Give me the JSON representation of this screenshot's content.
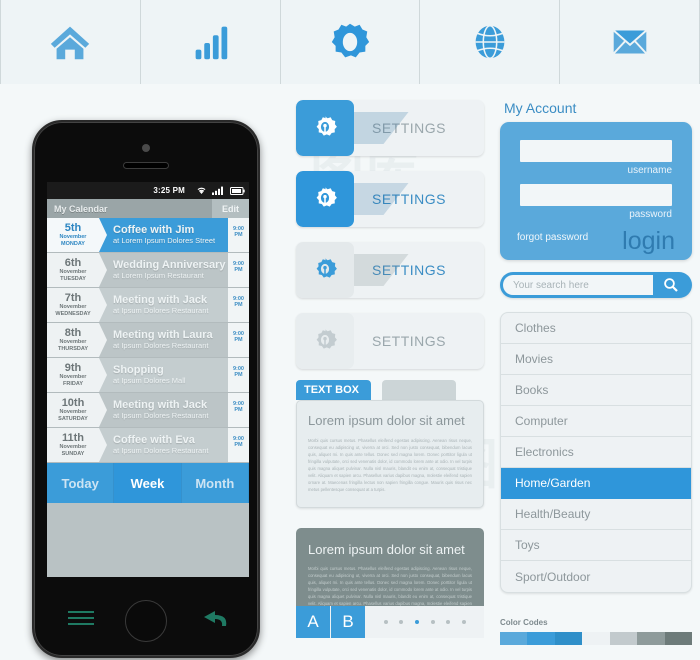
{
  "toolbar": {
    "items": [
      {
        "icon": "home-icon",
        "label": "Home"
      },
      {
        "icon": "bar-chart-icon",
        "label": "Statistics"
      },
      {
        "icon": "gear-icon",
        "label": "Settings"
      },
      {
        "icon": "globe-icon",
        "label": "Web"
      },
      {
        "icon": "envelope-icon",
        "label": "Mail"
      }
    ]
  },
  "phone": {
    "status": {
      "time": "3:25 PM",
      "wifi": "wifi-icon",
      "signal": "signal-icon",
      "battery": "battery-icon"
    },
    "calendar": {
      "title": "My Calendar",
      "edit_label": "Edit",
      "events": [
        {
          "day": "5th",
          "month": "November",
          "weekday": "MONDAY",
          "title": "Coffee with Jim",
          "place": "at Lorem Ipsum Dolores Street",
          "time1": "9:00",
          "time2": "PM",
          "active": true
        },
        {
          "day": "6th",
          "month": "November",
          "weekday": "TUESDAY",
          "title": "Wedding Anniversary",
          "place": "at Lorem Ipsum Restaurant",
          "time1": "9:00",
          "time2": "PM",
          "active": false
        },
        {
          "day": "7th",
          "month": "November",
          "weekday": "WEDNESDAY",
          "title": "Meeting with Jack",
          "place": "at Ipsum Dolores Restaurant",
          "time1": "9:00",
          "time2": "PM",
          "active": false
        },
        {
          "day": "8th",
          "month": "November",
          "weekday": "THURSDAY",
          "title": "Meeting with Laura",
          "place": "at Ipsum Dolores Restaurant",
          "time1": "9:00",
          "time2": "PM",
          "active": false
        },
        {
          "day": "9th",
          "month": "November",
          "weekday": "FRIDAY",
          "title": "Shopping",
          "place": "at Ipsum Dolores Mall",
          "time1": "9:00",
          "time2": "PM",
          "active": false
        },
        {
          "day": "10th",
          "month": "November",
          "weekday": "SATURDAY",
          "title": "Meeting with Jack",
          "place": "at Ipsum Dolores Restaurant",
          "time1": "9:00",
          "time2": "PM",
          "active": false
        },
        {
          "day": "11th",
          "month": "November",
          "weekday": "SUNDAY",
          "title": "Coffee with Eva",
          "place": "at Ipsum Dolores Restaurant",
          "time1": "9:00",
          "time2": "PM",
          "active": false
        }
      ],
      "tabs": [
        {
          "label": "Today",
          "selected": false
        },
        {
          "label": "Week",
          "selected": true
        },
        {
          "label": "Month",
          "selected": false
        }
      ]
    },
    "hardware": {
      "menu": "menu-icon",
      "home": "home-button",
      "back": "back-icon"
    }
  },
  "settings_buttons": [
    {
      "label": "SETTINGS",
      "icon": "gear-icon",
      "style": "blue-icon-gray-label"
    },
    {
      "label": "SETTINGS",
      "icon": "gear-icon",
      "style": "blue-icon-blue-label"
    },
    {
      "label": "SETTINGS",
      "icon": "gear-icon",
      "style": "gray-icon-blue-label"
    },
    {
      "label": "SETTINGS",
      "icon": "gear-icon",
      "style": "gray-icon-gray-label"
    }
  ],
  "textbox": {
    "tab_label": "TEXT BOX",
    "title": "Lorem ipsum dolor sit amet",
    "body": "Morbi quis cursus metus. Phasellus eleifend egestas adipiscing. Aenean risus neque, consequat eu adipiscing ut, viverra at orci. Sed non justo consequat, bibendum lacus quis, aliquet mi. In quis ante tellus. Donec sed magna lorem. Donec porttitor ligula ut fringilla vulputate, orci sed venenatis dolor, id commodo lorem ante at odio. In vel turpis quis magna aliquet pulvinar. Nulla nisl mauris, blandit eu enim at, consequat tristique velit. Aliquam et sapien arcu. Phasellus varius dapibus magna, molestie eleifend sapien ornare at. Maecenas fringilla lectus non sapien fringilla congue. Mauris quis risus nec metus pellentesque consequat at a turpis."
  },
  "gray_panel": {
    "title": "Lorem ipsum dolor sit amet",
    "body": "Morbi quis cursus metus. Phasellus eleifend egestas adipiscing. Aenean risus neque, consequat eu adipiscing ut, viverra at orci. Sed non justo consequat, bibendum lacus quis, aliquet mi. In quis ante tellus. Donec sed magna lorem. Donec porttitor ligula ut fringilla vulputate, orci sed venenatis dolor, id commodo lorem ante at odio. In vel turpis quis magna aliquet pulvinar. Nulla nisl mauris, blandit eu enim at, consequat tristique velit. Aliquam et sapien arcu. Phasellus varius dapibus magna, molestie eleifend sapien ornare at. Maecenas fringilla lectus non sapien fringilla congue. Mauris quis risus nec metus pellentesque consequat a turpis.",
    "button_a": "A",
    "button_b": "B",
    "dots_count": 6,
    "dot_active_index": 2
  },
  "account": {
    "title": "My Account",
    "username_value": "",
    "username_label": "username",
    "password_value": "",
    "password_label": "password",
    "forgot_label": "forgot password",
    "login_label": "login"
  },
  "search": {
    "placeholder": "Your search here",
    "value": "",
    "icon": "search-icon"
  },
  "categories": {
    "items": [
      {
        "label": "Clothes",
        "selected": false
      },
      {
        "label": "Movies",
        "selected": false
      },
      {
        "label": "Books",
        "selected": false
      },
      {
        "label": "Computer",
        "selected": false
      },
      {
        "label": "Electronics",
        "selected": false
      },
      {
        "label": "Home/Garden",
        "selected": true
      },
      {
        "label": "Health/Beauty",
        "selected": false
      },
      {
        "label": "Toys",
        "selected": false
      },
      {
        "label": "Sport/Outdoor",
        "selected": false
      }
    ]
  },
  "color_codes": {
    "title": "Color Codes",
    "swatches": [
      "#5aa9db",
      "#3b9cd9",
      "#2f8fc9",
      "#eef2f4",
      "#c2cacd",
      "#8e9b9b",
      "#6d7b7a"
    ]
  },
  "watermark": {
    "text1": "图库",
    "text2": "科图"
  }
}
